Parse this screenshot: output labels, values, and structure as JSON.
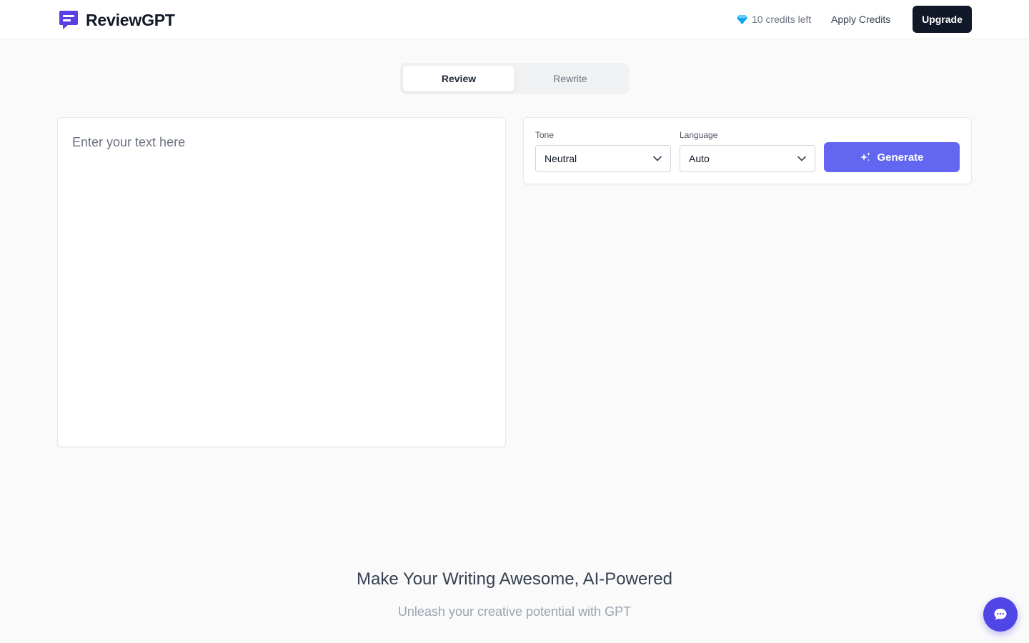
{
  "header": {
    "brand_name": "ReviewGPT",
    "credits_text": "10 credits left",
    "apply_credits_label": "Apply Credits",
    "upgrade_label": "Upgrade"
  },
  "tabs": [
    {
      "label": "Review",
      "active": true
    },
    {
      "label": "Rewrite",
      "active": false
    }
  ],
  "editor": {
    "placeholder": "Enter your text here",
    "value": ""
  },
  "controls": {
    "tone": {
      "label": "Tone",
      "selected": "Neutral"
    },
    "language": {
      "label": "Language",
      "selected": "Auto"
    },
    "generate_label": "Generate"
  },
  "hero": {
    "title": "Make Your Writing Awesome, AI-Powered",
    "subtitle": "Unleash your creative potential with GPT"
  },
  "icons": {
    "brand": "chat-bubble-logo-icon",
    "credits": "gem-icon",
    "select": "chevron-down-icon",
    "generate": "sparkles-icon",
    "chat": "chat-bubble-icon"
  },
  "colors": {
    "accent": "#6366f1",
    "brand": "#5b3fe0",
    "dark_button": "#111827",
    "chat_fab": "#4f46e5",
    "gem": "#38bdf8"
  }
}
